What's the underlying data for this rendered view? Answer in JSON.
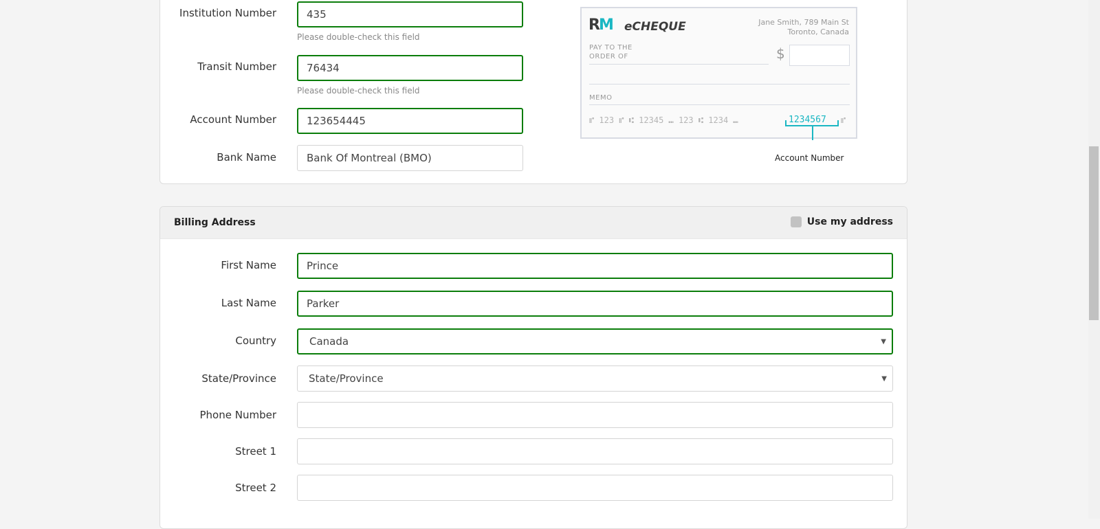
{
  "bank": {
    "fields": [
      {
        "label": "Institution Number",
        "value": "435",
        "hint": "Please double-check this field"
      },
      {
        "label": "Transit Number",
        "value": "76434",
        "hint": "Please double-check this field"
      },
      {
        "label": "Account Number",
        "value": "123654445"
      },
      {
        "label": "Bank Name",
        "value": "Bank Of Montreal (BMO)"
      }
    ],
    "cheque": {
      "logo": "RM eCHEQUE",
      "brand_text": "eCHEQUE",
      "address_line1": "Jane Smith, 789 Main St",
      "address_line2": "Toronto, Canada",
      "pay_line1": "PAY TO THE",
      "pay_line2": "ORDER OF",
      "dollar": "$",
      "memo": "MEMO",
      "micr": "⑈ 123 ⑈ ⑆ 12345 ⑉ 123 ⑆ 1234 ⑉",
      "micr_account": "1234567",
      "micr_end": "⑈",
      "callout": "Account Number",
      "accent_color": "#1ab7c3"
    }
  },
  "billing": {
    "title": "Billing Address",
    "use_my_address": "Use my address",
    "use_my_address_checked": false,
    "fields": [
      {
        "label": "First Name",
        "value": "Prince"
      },
      {
        "label": "Last Name",
        "value": "Parker"
      },
      {
        "label": "Country",
        "value": "Canada"
      },
      {
        "label": "State/Province",
        "value": "State/Province"
      },
      {
        "label": "Phone Number",
        "value": ""
      },
      {
        "label": "Street 1",
        "value": ""
      },
      {
        "label": "Street 2",
        "value": ""
      }
    ]
  },
  "colors": {
    "valid_border": "#0a7d0a",
    "background": "#f4f4f4"
  }
}
